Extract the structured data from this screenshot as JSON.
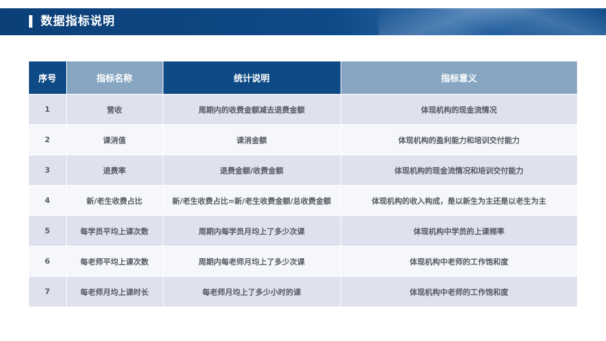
{
  "header": {
    "title": "数据指标说明"
  },
  "table": {
    "columns": [
      "序号",
      "指标名称",
      "统计说明",
      "指标意义"
    ],
    "rows": [
      {
        "index": "1",
        "name": "营收",
        "calc": "周期内的收费金额减去退费金额",
        "meaning": "体现机构的现金流情况"
      },
      {
        "index": "2",
        "name": "课消值",
        "calc": "课消金额",
        "meaning": "体现机构的盈利能力和培训交付能力"
      },
      {
        "index": "3",
        "name": "退费率",
        "calc": "退费金额/收费金额",
        "meaning": "体现机构的现金流情况和培训交付能力"
      },
      {
        "index": "4",
        "name": "新/老生收费占比",
        "calc": "新/老生收费占比=新/老生收费金额/总收费金额",
        "meaning": "体现机构的收入构成，是以新生为主还是以老生为主"
      },
      {
        "index": "5",
        "name": "每学员平均上课次数",
        "calc": "周期内每学员月均上了多少次课",
        "meaning": "体现机构中学员的上课频率"
      },
      {
        "index": "6",
        "name": "每老师平均上课次数",
        "calc": "周期内每老师月均上了多少次课",
        "meaning": "体现机构中老师的工作饱和度"
      },
      {
        "index": "7",
        "name": "每老师月均上课时长",
        "calc": "每老师月均上了多少小时的课",
        "meaning": "体现机构中老师的工作饱和度"
      }
    ]
  },
  "colors": {
    "header_dark": "#0e4a86",
    "header_light": "#86a6c2",
    "row_odd": "#dee2ef",
    "row_even": "#f6f7fa"
  }
}
